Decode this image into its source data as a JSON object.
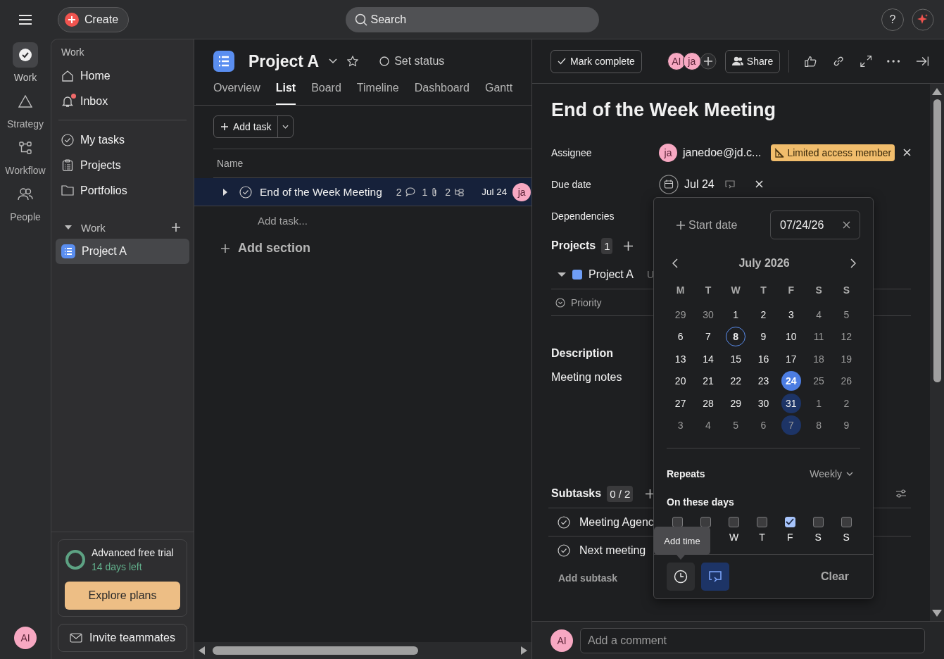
{
  "top_bar": {
    "create_label": "Create",
    "search_placeholder": "Search",
    "help_label": "?"
  },
  "rail": {
    "items": [
      {
        "label": "Work",
        "kind": "check",
        "selected": true
      },
      {
        "label": "Strategy",
        "kind": "triangle",
        "selected": false
      },
      {
        "label": "Workflow",
        "kind": "flow",
        "selected": false
      },
      {
        "label": "People",
        "kind": "people",
        "selected": false
      }
    ],
    "user_avatar": "AI"
  },
  "sidebar": {
    "heading": "Work",
    "nav": [
      {
        "label": "Home",
        "kind": "home",
        "unread": false
      },
      {
        "label": "Inbox",
        "kind": "bell",
        "unread": true
      }
    ],
    "links": [
      {
        "label": "My tasks",
        "kind": "check"
      },
      {
        "label": "Projects",
        "kind": "clipboard"
      },
      {
        "label": "Portfolios",
        "kind": "folder"
      }
    ],
    "section": {
      "label": "Work",
      "expanded": true,
      "projects": [
        {
          "label": "Project A",
          "selected": true
        }
      ]
    },
    "trial": {
      "title": "Advanced free trial",
      "days_left": "14 days left",
      "button": "Explore plans"
    },
    "invite": "Invite teammates"
  },
  "project": {
    "title": "Project A",
    "status": "Set status",
    "tabs": [
      {
        "label": "Overview",
        "selected": false
      },
      {
        "label": "List",
        "selected": true
      },
      {
        "label": "Board",
        "selected": false
      },
      {
        "label": "Timeline",
        "selected": false
      },
      {
        "label": "Dashboard",
        "selected": false
      },
      {
        "label": "Gantt",
        "selected": false
      }
    ]
  },
  "list": {
    "add_task": "Add task",
    "column": "Name",
    "tasks": [
      {
        "name": "End of the Week Meeting",
        "selected": true,
        "completed": false,
        "comments": "2",
        "attachments": "1",
        "subtasks": "2",
        "due": "Jul 24",
        "assignee": "ja"
      }
    ],
    "add_task_row": "Add task...",
    "add_section": "Add section"
  },
  "detail": {
    "mark_complete": "Mark complete",
    "collaborators": [
      "AI",
      "ja"
    ],
    "share": "Share",
    "title": "End of the Week Meeting",
    "assignee": {
      "label": "Assignee",
      "avatar": "ja",
      "name": "janedoe@jd.c...",
      "badge": "Limited access member"
    },
    "due_date": {
      "label": "Due date",
      "value": "Jul 24",
      "repeats": true
    },
    "dependencies": {
      "label": "Dependencies"
    },
    "projects": {
      "label": "Projects",
      "count": "1",
      "items": [
        {
          "name": "Project A",
          "expanded": true,
          "section": "U"
        }
      ],
      "priority_label": "Priority"
    },
    "description": {
      "label": "Description",
      "text": "Meeting notes"
    },
    "subtasks": {
      "label": "Subtasks",
      "count": "0 / 2",
      "items": [
        {
          "name": "Meeting Agenc",
          "completed": false
        },
        {
          "name": "Next meeting",
          "completed": false
        }
      ],
      "add": "Add subtask"
    },
    "comment": {
      "avatar": "AI",
      "placeholder": "Add a comment"
    }
  },
  "date_picker": {
    "start_date": "Start date",
    "date_value": "07/24/26",
    "month": "July 2026",
    "weekdays": [
      "M",
      "T",
      "W",
      "T",
      "F",
      "S",
      "S"
    ],
    "weeks": [
      [
        {
          "day": "29",
          "muted": true,
          "selected": false,
          "today": false,
          "repeat": false
        },
        {
          "day": "30",
          "muted": true,
          "selected": false,
          "today": false,
          "repeat": false
        },
        {
          "day": "1",
          "muted": false,
          "selected": false,
          "today": false,
          "repeat": false
        },
        {
          "day": "2",
          "muted": false,
          "selected": false,
          "today": false,
          "repeat": false
        },
        {
          "day": "3",
          "muted": false,
          "selected": false,
          "today": false,
          "repeat": false
        },
        {
          "day": "4",
          "muted": true,
          "selected": false,
          "today": false,
          "repeat": false
        },
        {
          "day": "5",
          "muted": true,
          "selected": false,
          "today": false,
          "repeat": false
        }
      ],
      [
        {
          "day": "6",
          "muted": false,
          "selected": false,
          "today": false,
          "repeat": false
        },
        {
          "day": "7",
          "muted": false,
          "selected": false,
          "today": false,
          "repeat": false
        },
        {
          "day": "8",
          "muted": false,
          "selected": false,
          "today": true,
          "repeat": false
        },
        {
          "day": "9",
          "muted": false,
          "selected": false,
          "today": false,
          "repeat": false
        },
        {
          "day": "10",
          "muted": false,
          "selected": false,
          "today": false,
          "repeat": false
        },
        {
          "day": "11",
          "muted": true,
          "selected": false,
          "today": false,
          "repeat": false
        },
        {
          "day": "12",
          "muted": true,
          "selected": false,
          "today": false,
          "repeat": false
        }
      ],
      [
        {
          "day": "13",
          "muted": false,
          "selected": false,
          "today": false,
          "repeat": false
        },
        {
          "day": "14",
          "muted": false,
          "selected": false,
          "today": false,
          "repeat": false
        },
        {
          "day": "15",
          "muted": false,
          "selected": false,
          "today": false,
          "repeat": false
        },
        {
          "day": "16",
          "muted": false,
          "selected": false,
          "today": false,
          "repeat": false
        },
        {
          "day": "17",
          "muted": false,
          "selected": false,
          "today": false,
          "repeat": false
        },
        {
          "day": "18",
          "muted": true,
          "selected": false,
          "today": false,
          "repeat": false
        },
        {
          "day": "19",
          "muted": true,
          "selected": false,
          "today": false,
          "repeat": false
        }
      ],
      [
        {
          "day": "20",
          "muted": false,
          "selected": false,
          "today": false,
          "repeat": false
        },
        {
          "day": "21",
          "muted": false,
          "selected": false,
          "today": false,
          "repeat": false
        },
        {
          "day": "22",
          "muted": false,
          "selected": false,
          "today": false,
          "repeat": false
        },
        {
          "day": "23",
          "muted": false,
          "selected": false,
          "today": false,
          "repeat": false
        },
        {
          "day": "24",
          "muted": false,
          "selected": true,
          "today": false,
          "repeat": false
        },
        {
          "day": "25",
          "muted": true,
          "selected": false,
          "today": false,
          "repeat": false
        },
        {
          "day": "26",
          "muted": true,
          "selected": false,
          "today": false,
          "repeat": false
        }
      ],
      [
        {
          "day": "27",
          "muted": false,
          "selected": false,
          "today": false,
          "repeat": false
        },
        {
          "day": "28",
          "muted": false,
          "selected": false,
          "today": false,
          "repeat": false
        },
        {
          "day": "29",
          "muted": false,
          "selected": false,
          "today": false,
          "repeat": false
        },
        {
          "day": "30",
          "muted": false,
          "selected": false,
          "today": false,
          "repeat": false
        },
        {
          "day": "31",
          "muted": false,
          "selected": false,
          "today": false,
          "repeat": true
        },
        {
          "day": "1",
          "muted": true,
          "selected": false,
          "today": false,
          "repeat": false
        },
        {
          "day": "2",
          "muted": true,
          "selected": false,
          "today": false,
          "repeat": false
        }
      ],
      [
        {
          "day": "3",
          "muted": true,
          "selected": false,
          "today": false,
          "repeat": false
        },
        {
          "day": "4",
          "muted": true,
          "selected": false,
          "today": false,
          "repeat": false
        },
        {
          "day": "5",
          "muted": true,
          "selected": false,
          "today": false,
          "repeat": false
        },
        {
          "day": "6",
          "muted": true,
          "selected": false,
          "today": false,
          "repeat": false
        },
        {
          "day": "7",
          "muted": true,
          "selected": false,
          "today": false,
          "repeat": true
        },
        {
          "day": "8",
          "muted": true,
          "selected": false,
          "today": false,
          "repeat": false
        },
        {
          "day": "9",
          "muted": true,
          "selected": false,
          "today": false,
          "repeat": false
        }
      ]
    ],
    "repeats_label": "Repeats",
    "repeat_mode": "Weekly",
    "days_label": "On these days",
    "days": [
      {
        "checked": false
      },
      {
        "checked": false
      },
      {
        "label": "W",
        "checked": false
      },
      {
        "label": "T",
        "checked": false
      },
      {
        "label": "F",
        "checked": true
      },
      {
        "label": "S",
        "checked": false
      },
      {
        "label": "S",
        "checked": false
      }
    ],
    "tooltip": "Add time",
    "repeat_on": true,
    "clear": "Clear"
  }
}
